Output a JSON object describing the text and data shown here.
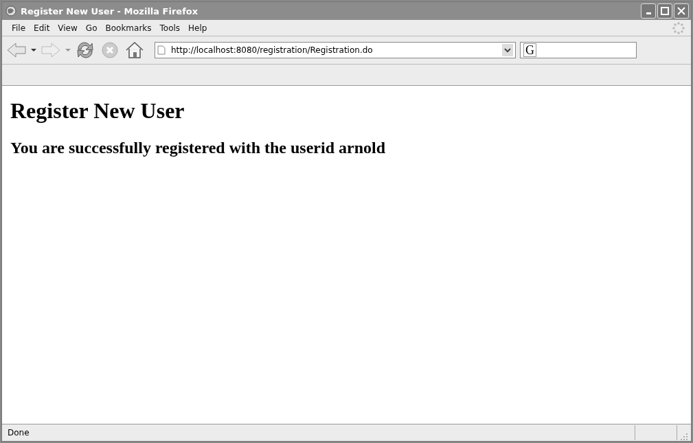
{
  "window": {
    "title": "Register New User - Mozilla Firefox"
  },
  "menu": [
    "File",
    "Edit",
    "View",
    "Go",
    "Bookmarks",
    "Tools",
    "Help"
  ],
  "toolbar": {
    "address": "http://localhost:8080/registration/Registration.do",
    "search_engine": "G"
  },
  "page": {
    "heading": "Register New User",
    "message": "You are successfully registered with the userid arnold"
  },
  "status_bar": {
    "text": "Done"
  }
}
